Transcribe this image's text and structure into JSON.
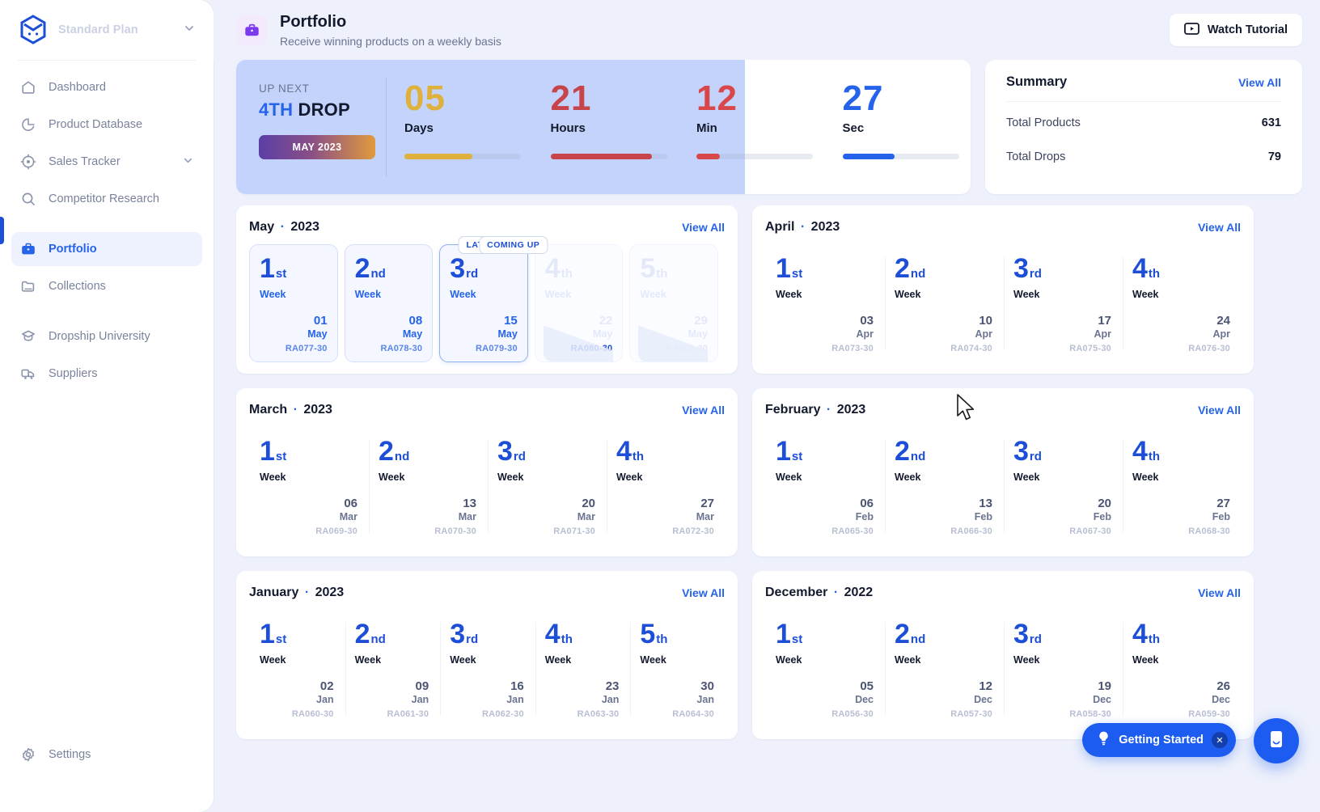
{
  "sidebar": {
    "plan_label": "Standard Plan",
    "items": [
      {
        "label": "Dashboard",
        "icon": "home-icon",
        "caret": false
      },
      {
        "label": "Product Database",
        "icon": "pie-chart-icon",
        "caret": false
      },
      {
        "label": "Sales Tracker",
        "icon": "target-icon",
        "caret": true
      },
      {
        "label": "Competitor Research",
        "icon": "search-icon",
        "caret": false
      },
      {
        "label": "Portfolio",
        "icon": "briefcase-icon",
        "caret": false
      },
      {
        "label": "Collections",
        "icon": "folder-icon",
        "caret": false
      },
      {
        "label": "Dropship University",
        "icon": "graduation-icon",
        "caret": false
      },
      {
        "label": "Suppliers",
        "icon": "truck-icon",
        "caret": false
      }
    ],
    "settings_label": "Settings",
    "active_item": "Portfolio"
  },
  "header": {
    "icon": "briefcase-icon",
    "title": "Portfolio",
    "subtitle": "Receive winning products on a weekly basis",
    "watch_tutorial_label": "Watch Tutorial"
  },
  "countdown": {
    "up_next_label": "UP NEXT",
    "drop_ordinal": "4TH",
    "drop_word": "DROP",
    "month_pill": "MAY 2023",
    "units": [
      {
        "value": "05",
        "label": "Days",
        "color": "#ddb13c",
        "progress": 58
      },
      {
        "value": "21",
        "label": "Hours",
        "color": "#c6444a",
        "progress": 87
      },
      {
        "value": "12",
        "label": "Min",
        "color": "#d8484a",
        "progress": 20
      },
      {
        "value": "27",
        "label": "Sec",
        "color": "#2563eb",
        "progress": 45
      }
    ]
  },
  "summary": {
    "title": "Summary",
    "view_all_label": "View All",
    "rows": [
      {
        "key": "Total Products",
        "value": "631"
      },
      {
        "key": "Total Drops",
        "value": "79"
      }
    ]
  },
  "view_all_label": "View All",
  "badges": {
    "latest": "LATEST",
    "coming_up": "COMING UP"
  },
  "months": [
    {
      "name": "May",
      "year": "2023",
      "variant": "may",
      "weeks": [
        {
          "n": "1",
          "suffix": "st",
          "week_label": "Week",
          "day": "01",
          "mon": "May",
          "code": "RA077-30",
          "state": "normal"
        },
        {
          "n": "2",
          "suffix": "nd",
          "week_label": "Week",
          "day": "08",
          "mon": "May",
          "code": "RA078-30",
          "state": "normal"
        },
        {
          "n": "3",
          "suffix": "rd",
          "week_label": "Week",
          "day": "15",
          "mon": "May",
          "code": "RA079-30",
          "state": "latest",
          "badge": "LATEST"
        },
        {
          "n": "4",
          "suffix": "th",
          "week_label": "Week",
          "day": "22",
          "mon": "May",
          "code": "RA080-30",
          "state": "next",
          "badge": "COMING UP"
        },
        {
          "n": "5",
          "suffix": "th",
          "week_label": "Week",
          "day": "29",
          "mon": "May",
          "code": "RA081-30",
          "state": "dim"
        }
      ]
    },
    {
      "name": "April",
      "year": "2023",
      "variant": "plain",
      "weeks": [
        {
          "n": "1",
          "suffix": "st",
          "week_label": "Week",
          "day": "03",
          "mon": "Apr",
          "code": "RA073-30",
          "state": "normal"
        },
        {
          "n": "2",
          "suffix": "nd",
          "week_label": "Week",
          "day": "10",
          "mon": "Apr",
          "code": "RA074-30",
          "state": "normal"
        },
        {
          "n": "3",
          "suffix": "rd",
          "week_label": "Week",
          "day": "17",
          "mon": "Apr",
          "code": "RA075-30",
          "state": "normal"
        },
        {
          "n": "4",
          "suffix": "th",
          "week_label": "Week",
          "day": "24",
          "mon": "Apr",
          "code": "RA076-30",
          "state": "normal"
        }
      ]
    },
    {
      "name": "March",
      "year": "2023",
      "variant": "plain",
      "weeks": [
        {
          "n": "1",
          "suffix": "st",
          "week_label": "Week",
          "day": "06",
          "mon": "Mar",
          "code": "RA069-30",
          "state": "normal"
        },
        {
          "n": "2",
          "suffix": "nd",
          "week_label": "Week",
          "day": "13",
          "mon": "Mar",
          "code": "RA070-30",
          "state": "normal"
        },
        {
          "n": "3",
          "suffix": "rd",
          "week_label": "Week",
          "day": "20",
          "mon": "Mar",
          "code": "RA071-30",
          "state": "normal"
        },
        {
          "n": "4",
          "suffix": "th",
          "week_label": "Week",
          "day": "27",
          "mon": "Mar",
          "code": "RA072-30",
          "state": "normal"
        }
      ]
    },
    {
      "name": "February",
      "year": "2023",
      "variant": "plain",
      "weeks": [
        {
          "n": "1",
          "suffix": "st",
          "week_label": "Week",
          "day": "06",
          "mon": "Feb",
          "code": "RA065-30",
          "state": "normal"
        },
        {
          "n": "2",
          "suffix": "nd",
          "week_label": "Week",
          "day": "13",
          "mon": "Feb",
          "code": "RA066-30",
          "state": "normal"
        },
        {
          "n": "3",
          "suffix": "rd",
          "week_label": "Week",
          "day": "20",
          "mon": "Feb",
          "code": "RA067-30",
          "state": "normal"
        },
        {
          "n": "4",
          "suffix": "th",
          "week_label": "Week",
          "day": "27",
          "mon": "Feb",
          "code": "RA068-30",
          "state": "normal"
        }
      ]
    },
    {
      "name": "January",
      "year": "2023",
      "variant": "plain",
      "weeks": [
        {
          "n": "1",
          "suffix": "st",
          "week_label": "Week",
          "day": "02",
          "mon": "Jan",
          "code": "RA060-30",
          "state": "normal"
        },
        {
          "n": "2",
          "suffix": "nd",
          "week_label": "Week",
          "day": "09",
          "mon": "Jan",
          "code": "RA061-30",
          "state": "normal"
        },
        {
          "n": "3",
          "suffix": "rd",
          "week_label": "Week",
          "day": "16",
          "mon": "Jan",
          "code": "RA062-30",
          "state": "normal"
        },
        {
          "n": "4",
          "suffix": "th",
          "week_label": "Week",
          "day": "23",
          "mon": "Jan",
          "code": "RA063-30",
          "state": "normal"
        },
        {
          "n": "5",
          "suffix": "th",
          "week_label": "Week",
          "day": "30",
          "mon": "Jan",
          "code": "RA064-30",
          "state": "normal"
        }
      ]
    },
    {
      "name": "December",
      "year": "2022",
      "variant": "plain",
      "weeks": [
        {
          "n": "1",
          "suffix": "st",
          "week_label": "Week",
          "day": "05",
          "mon": "Dec",
          "code": "RA056-30",
          "state": "normal"
        },
        {
          "n": "2",
          "suffix": "nd",
          "week_label": "Week",
          "day": "12",
          "mon": "Dec",
          "code": "RA057-30",
          "state": "normal"
        },
        {
          "n": "3",
          "suffix": "rd",
          "week_label": "Week",
          "day": "19",
          "mon": "Dec",
          "code": "RA058-30",
          "state": "normal"
        },
        {
          "n": "4",
          "suffix": "th",
          "week_label": "Week",
          "day": "26",
          "mon": "Dec",
          "code": "RA059-30",
          "state": "normal"
        }
      ]
    }
  ],
  "widgets": {
    "getting_started_label": "Getting Started",
    "getting_started_icon": "lightbulb-icon",
    "close_icon": "close-icon",
    "chat_icon": "chat-icon"
  },
  "colors": {
    "accent": "#2563eb",
    "accent_dark": "#1d4ed8",
    "banner": "#c3d3fb",
    "purple": "#7c3aed"
  }
}
